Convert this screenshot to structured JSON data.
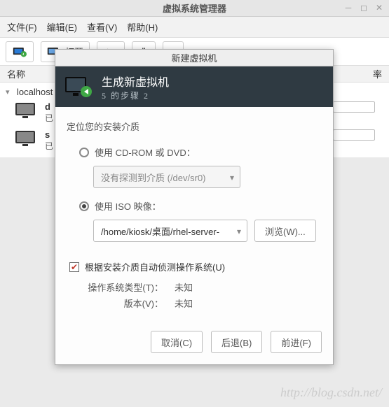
{
  "main_window": {
    "title": "虚拟系统管理器",
    "menu": {
      "file": "文件(F)",
      "edit": "编辑(E)",
      "view": "查看(V)",
      "help": "帮助(H)"
    },
    "toolbar": {
      "open_label": "打开"
    },
    "columns": {
      "name": "名称",
      "rate": "率"
    },
    "tree": {
      "host": "localhost (",
      "vms": [
        {
          "name": "d",
          "status": "已"
        },
        {
          "name": "s",
          "status": "已"
        }
      ]
    }
  },
  "dialog": {
    "title": "新建虚拟机",
    "header": {
      "title": "生成新虚拟机",
      "step": "5 的步骤 2"
    },
    "prompt": "定位您的安装介质",
    "options": {
      "cdrom_label": "使用 CD-ROM 或 DVD：",
      "cdrom_placeholder": "没有探测到介质 (/dev/sr0)",
      "iso_label": "使用 ISO 映像：",
      "iso_value": "/home/kiosk/桌面/rhel-server-",
      "browse_label": "浏览(W)..."
    },
    "autodetect_label": "根据安装介质自动侦测操作系统(U)",
    "os_type_label": "操作系统类型(T)：",
    "os_type_value": "未知",
    "version_label": "版本(V)：",
    "version_value": "未知",
    "buttons": {
      "cancel": "取消(C)",
      "back": "后退(B)",
      "forward": "前进(F)"
    }
  },
  "watermark": "http://blog.csdn.net/"
}
